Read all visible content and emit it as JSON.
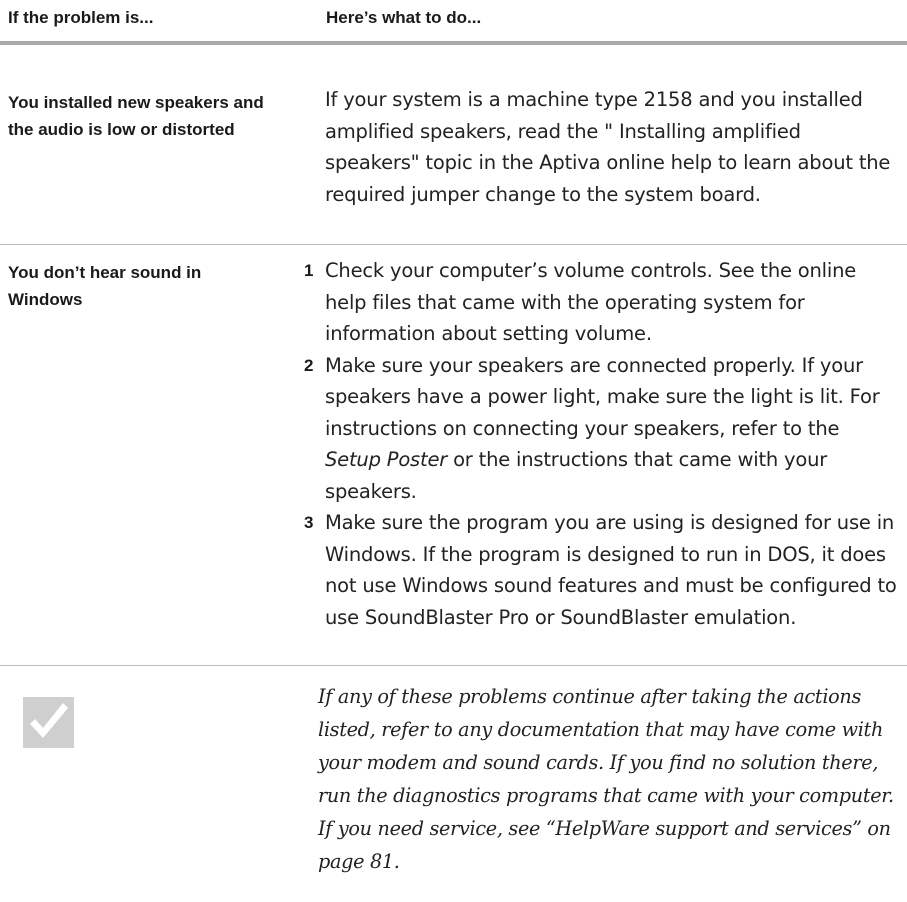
{
  "header": {
    "col1": "If the problem is...",
    "col2": "Here’s what to do..."
  },
  "rows": [
    {
      "problem": "You installed new speakers and the audio is low or distorted",
      "answer": "If your system is a machine type 2158 and you installed amplified speakers, read the \" Installing amplified speakers\" topic in the Aptiva online help to learn about the required jumper change to the system board."
    },
    {
      "problem": "You don’t hear sound in Windows",
      "steps": [
        {
          "num": "1",
          "text": "Check your computer’s volume controls. See the online help files that came with the operating system for information about setting volume."
        },
        {
          "num": "2",
          "text_before": "Make sure your speakers are connected properly. If your speakers have a power light, make sure the light is lit. For instructions on connecting your speakers, refer to the ",
          "italic": "Setup Poster",
          "text_after": " or the instructions that came with your speakers."
        },
        {
          "num": "3",
          "text": "Make sure the program you are using is designed for use in Windows. If the program is designed to run in DOS, it does not use Windows sound features and must be configured to use SoundBlaster Pro or SoundBlaster emulation."
        }
      ]
    }
  ],
  "note": {
    "icon": "checkmark-icon",
    "text": "If any of these problems continue after taking the actions listed, refer to any documentation that may have come with your modem and sound cards. If you find no solution there, run the diagnostics programs that came with your computer. If you need service, see “HelpWare support and services” on page 81."
  },
  "colors": {
    "header_rule": "#a9a9a9",
    "row_rule": "#bdbdbd",
    "check_box": "#cfcfcf"
  }
}
